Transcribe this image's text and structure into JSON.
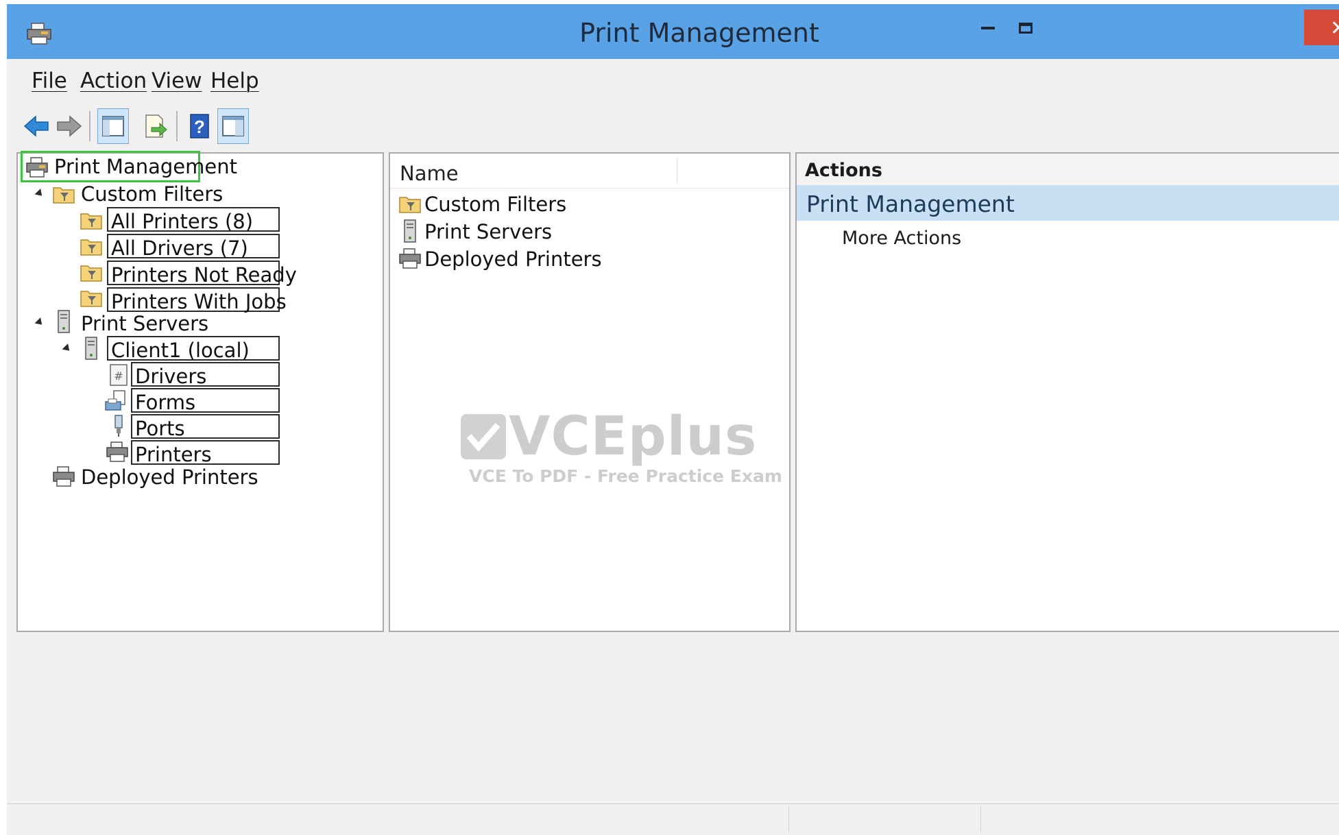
{
  "window": {
    "title": "Print Management"
  },
  "menubar": {
    "items": [
      "File",
      "Action",
      "View",
      "Help"
    ]
  },
  "toolbar": {
    "icons": [
      "back-arrow-icon",
      "forward-arrow-icon",
      "show-hide-console-tree-icon",
      "export-list-icon",
      "help-icon",
      "show-hide-action-pane-icon"
    ]
  },
  "tree": {
    "root": "Print Management",
    "custom_filters": "Custom Filters",
    "filters": [
      "All Printers (8)",
      "All Drivers (7)",
      "Printers Not Ready",
      "Printers With Jobs"
    ],
    "print_servers": "Print Servers",
    "client": "Client1 (local)",
    "client_children": [
      "Drivers",
      "Forms",
      "Ports",
      "Printers"
    ],
    "deployed_printers": "Deployed Printers"
  },
  "list": {
    "column_name": "Name",
    "items": [
      "Custom Filters",
      "Print Servers",
      "Deployed Printers"
    ]
  },
  "actions": {
    "header": "Actions",
    "section": "Print Management",
    "more": "More Actions"
  },
  "watermark": {
    "brand": "VCEplus",
    "tagline": "VCE To PDF - Free Practice Exam"
  },
  "colors": {
    "titlebar": "#5aa2e6",
    "selection_outline": "#3cc43c",
    "close": "#d54a38",
    "actions_section_bg": "#c9dff4"
  }
}
